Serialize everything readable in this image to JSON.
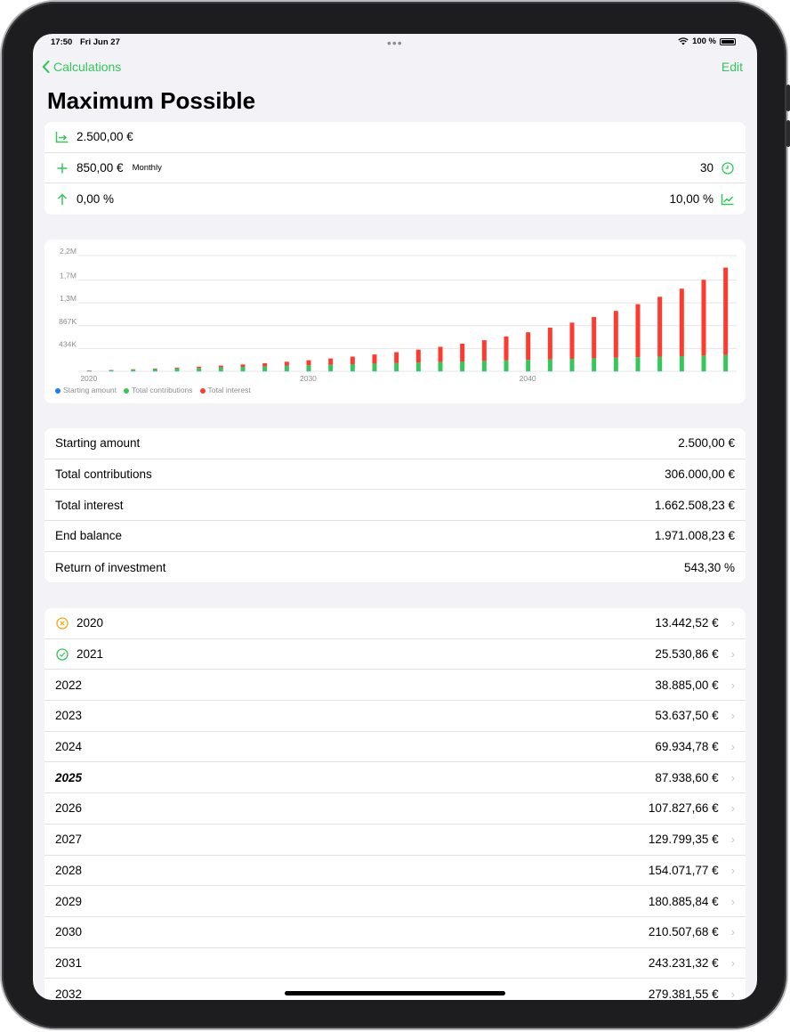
{
  "status": {
    "time": "17:50",
    "date": "Fri Jun 27",
    "battery": "100 %"
  },
  "nav": {
    "back_label": "Calculations",
    "edit_label": "Edit",
    "title": "Maximum Possible"
  },
  "inputs": {
    "starting_amount": "2.500,00 €",
    "contribution": "850,00 €",
    "frequency": "Monthly",
    "years": "30",
    "contribution_increase": "0,00 %",
    "interest_rate": "10,00 %"
  },
  "chart_data": {
    "type": "bar",
    "stacked": true,
    "x": [
      2020,
      2021,
      2022,
      2023,
      2024,
      2025,
      2026,
      2027,
      2028,
      2029,
      2030,
      2031,
      2032,
      2033,
      2034,
      2035,
      2036,
      2037,
      2038,
      2039,
      2040,
      2041,
      2042,
      2043,
      2044,
      2045,
      2046,
      2047,
      2048,
      2049
    ],
    "x_tick_labels": [
      "2020",
      "2030",
      "2040"
    ],
    "y_tick_labels": [
      "434K",
      "867K",
      "1,3M",
      "1,7M",
      "2,2M"
    ],
    "ylim": [
      0,
      2200000
    ],
    "legend": [
      "Starting amount",
      "Total contributions",
      "Total interest"
    ],
    "series": [
      {
        "name": "Starting amount",
        "color": "#1e7cf0",
        "values": [
          2500,
          2500,
          2500,
          2500,
          2500,
          2500,
          2500,
          2500,
          2500,
          2500,
          2500,
          2500,
          2500,
          2500,
          2500,
          2500,
          2500,
          2500,
          2500,
          2500,
          2500,
          2500,
          2500,
          2500,
          2500,
          2500,
          2500,
          2500,
          2500,
          2500
        ]
      },
      {
        "name": "Total contributions",
        "color": "#34c759",
        "values": [
          10200,
          20400,
          30600,
          40800,
          51000,
          61200,
          71400,
          81600,
          91800,
          102000,
          112200,
          122400,
          132600,
          142800,
          153000,
          163200,
          173400,
          183600,
          193800,
          204000,
          214200,
          224400,
          234600,
          244800,
          255000,
          265200,
          275400,
          285600,
          295800,
          306000
        ]
      },
      {
        "name": "Total interest",
        "color": "#ff3b30",
        "values": [
          742,
          2631,
          5785,
          10338,
          16435,
          24239,
          33928,
          45699,
          59772,
          76386,
          95808,
          118331,
          144281,
          174000,
          208000,
          246000,
          290000,
          339000,
          394000,
          456000,
          525000,
          602000,
          688000,
          784000,
          890000,
          1008000,
          1138000,
          1282000,
          1441000,
          1662508
        ]
      }
    ]
  },
  "summary": [
    {
      "label": "Starting amount",
      "value": "2.500,00 €"
    },
    {
      "label": "Total contributions",
      "value": "306.000,00 €"
    },
    {
      "label": "Total interest",
      "value": "1.662.508,23 €"
    },
    {
      "label": "End balance",
      "value": "1.971.008,23 €"
    },
    {
      "label": "Return of investment",
      "value": "543,30 %"
    }
  ],
  "years": [
    {
      "year": "2020",
      "value": "13.442,52 €",
      "status": "cancelled",
      "status_color": "#f5a623"
    },
    {
      "year": "2021",
      "value": "25.530,86 €",
      "status": "done",
      "status_color": "#34c759"
    },
    {
      "year": "2022",
      "value": "38.885,00 €"
    },
    {
      "year": "2023",
      "value": "53.637,50 €"
    },
    {
      "year": "2024",
      "value": "69.934,78 €"
    },
    {
      "year": "2025",
      "value": "87.938,60 €",
      "current": true
    },
    {
      "year": "2026",
      "value": "107.827,66 €"
    },
    {
      "year": "2027",
      "value": "129.799,35 €"
    },
    {
      "year": "2028",
      "value": "154.071,77 €"
    },
    {
      "year": "2029",
      "value": "180.885,84 €"
    },
    {
      "year": "2030",
      "value": "210.507,68 €"
    },
    {
      "year": "2031",
      "value": "243.231,32 €"
    },
    {
      "year": "2032",
      "value": "279.381,55 €"
    }
  ],
  "colors": {
    "accent": "#34c759",
    "background": "#f2f2f7"
  }
}
